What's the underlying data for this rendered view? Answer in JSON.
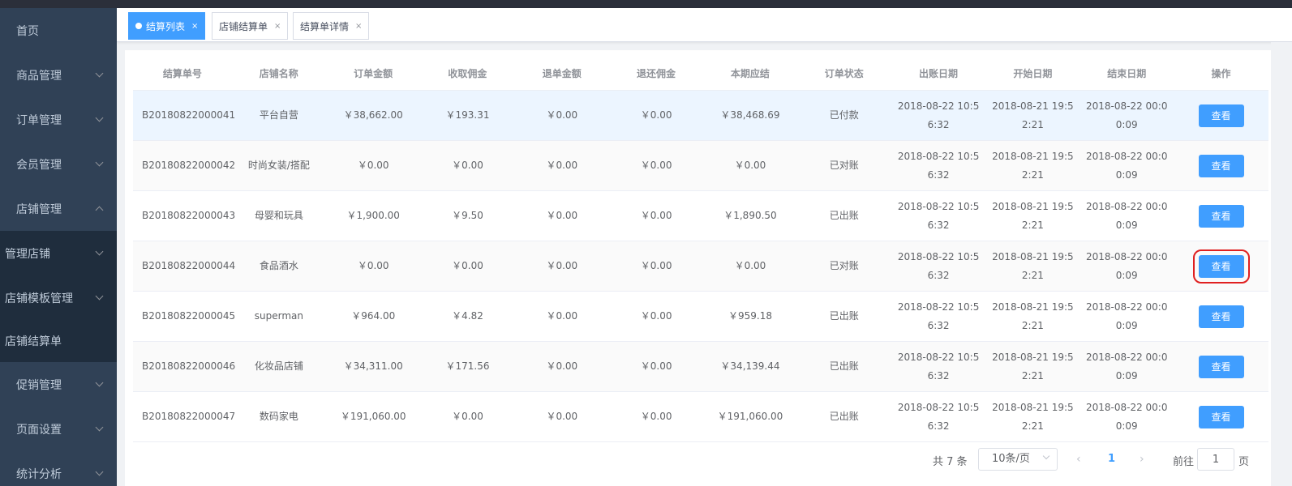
{
  "sidebar": {
    "items": [
      {
        "label": "首页",
        "chevron": ""
      },
      {
        "label": "商品管理",
        "chevron": "down"
      },
      {
        "label": "订单管理",
        "chevron": "down"
      },
      {
        "label": "会员管理",
        "chevron": "down"
      },
      {
        "label": "店铺管理",
        "chevron": "up"
      },
      {
        "label": "管理店铺",
        "chevron": "down"
      },
      {
        "label": "店铺模板管理",
        "chevron": "down"
      },
      {
        "label": "店铺结算单",
        "chevron": ""
      },
      {
        "label": "促销管理",
        "chevron": "down"
      },
      {
        "label": "页面设置",
        "chevron": "down"
      },
      {
        "label": "统计分析",
        "chevron": "down"
      }
    ]
  },
  "tabs": [
    {
      "label": "结算列表",
      "active": true
    },
    {
      "label": "店铺结算单",
      "active": false
    },
    {
      "label": "结算单详情",
      "active": false
    }
  ],
  "tab_close": "×",
  "table": {
    "headers": [
      "结算单号",
      "店铺名称",
      "订单金额",
      "收取佣金",
      "退单金额",
      "退还佣金",
      "本期应结",
      "订单状态",
      "出账日期",
      "开始日期",
      "结束日期",
      "操作"
    ],
    "rows": [
      [
        "B20180822000041",
        "平台自营",
        "￥38,662.00",
        "￥193.31",
        "￥0.00",
        "￥0.00",
        "￥38,468.69",
        "已付款",
        "2018-08-22 10:5",
        "6:32",
        "2018-08-21 19:5",
        "2:21",
        "2018-08-22 00:0",
        "0:09"
      ],
      [
        "B20180822000042",
        "时尚女装/搭配",
        "￥0.00",
        "￥0.00",
        "￥0.00",
        "￥0.00",
        "￥0.00",
        "已对账",
        "2018-08-22 10:5",
        "6:32",
        "2018-08-21 19:5",
        "2:21",
        "2018-08-22 00:0",
        "0:09"
      ],
      [
        "B20180822000043",
        "母婴和玩具",
        "￥1,900.00",
        "￥9.50",
        "￥0.00",
        "￥0.00",
        "￥1,890.50",
        "已出账",
        "2018-08-22 10:5",
        "6:32",
        "2018-08-21 19:5",
        "2:21",
        "2018-08-22 00:0",
        "0:09"
      ],
      [
        "B20180822000044",
        "食品酒水",
        "￥0.00",
        "￥0.00",
        "￥0.00",
        "￥0.00",
        "￥0.00",
        "已对账",
        "2018-08-22 10:5",
        "6:32",
        "2018-08-21 19:5",
        "2:21",
        "2018-08-22 00:0",
        "0:09"
      ],
      [
        "B20180822000045",
        "superman",
        "￥964.00",
        "￥4.82",
        "￥0.00",
        "￥0.00",
        "￥959.18",
        "已出账",
        "2018-08-22 10:5",
        "6:32",
        "2018-08-21 19:5",
        "2:21",
        "2018-08-22 00:0",
        "0:09"
      ],
      [
        "B20180822000046",
        "化妆品店铺",
        "￥34,311.00",
        "￥171.56",
        "￥0.00",
        "￥0.00",
        "￥34,139.44",
        "已出账",
        "2018-08-22 10:5",
        "6:32",
        "2018-08-21 19:5",
        "2:21",
        "2018-08-22 00:0",
        "0:09"
      ],
      [
        "B20180822000047",
        "数码家电",
        "￥191,060.00",
        "￥0.00",
        "￥0.00",
        "￥0.00",
        "￥191,060.00",
        "已出账",
        "2018-08-22 10:5",
        "6:32",
        "2018-08-21 19:5",
        "2:21",
        "2018-08-22 00:0",
        "0:09"
      ]
    ],
    "action_label": "查看"
  },
  "pagination": {
    "total": "共 7 条",
    "page_size": "10条/页",
    "prev": "‹",
    "current_page": "1",
    "next": "›",
    "goto_label": "前往",
    "goto_value": "1",
    "page_unit": "页"
  },
  "colors": {
    "accent": "#409eff",
    "sidebar_bg": "#304156",
    "highlight_box": "#e02020"
  }
}
